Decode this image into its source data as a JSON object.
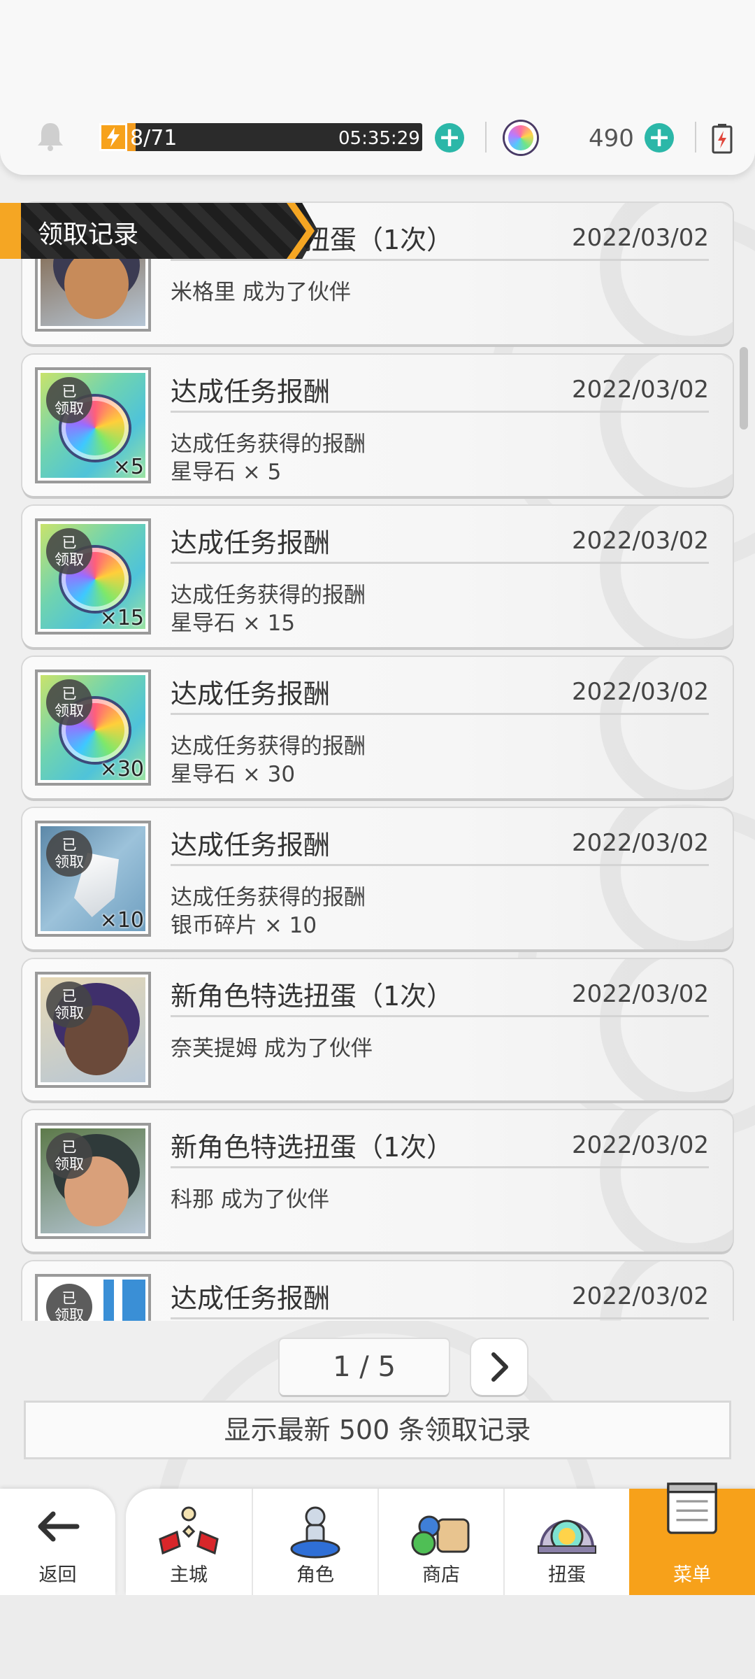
{
  "topbar": {
    "stamina_text": "8/71",
    "stamina_fraction": 0.113,
    "stamina_timer": "05:35:29",
    "gem_count": "490",
    "icons": [
      "bell-icon",
      "lightning-icon",
      "plus-icon",
      "rainbow-orb-icon",
      "battery-icon"
    ]
  },
  "section": {
    "title": "领取记录"
  },
  "records": [
    {
      "title": "新角色特选扭蛋（1次）",
      "date": "2022/03/02",
      "line1": "米格里 成为了伙伴",
      "line2": "",
      "thumb": "character",
      "qty": "",
      "claimed": false
    },
    {
      "title": "达成任务报酬",
      "date": "2022/03/02",
      "line1": "达成任务获得的报酬",
      "line2": "星导石 × 5",
      "thumb": "star-stone",
      "qty": "×5",
      "claimed": true
    },
    {
      "title": "达成任务报酬",
      "date": "2022/03/02",
      "line1": "达成任务获得的报酬",
      "line2": "星导石 × 15",
      "thumb": "star-stone",
      "qty": "×15",
      "claimed": true
    },
    {
      "title": "达成任务报酬",
      "date": "2022/03/02",
      "line1": "达成任务获得的报酬",
      "line2": "星导石 × 30",
      "thumb": "star-stone",
      "qty": "×30",
      "claimed": true
    },
    {
      "title": "达成任务报酬",
      "date": "2022/03/02",
      "line1": "达成任务获得的报酬",
      "line2": "银币碎片 × 10",
      "thumb": "silver-shard",
      "qty": "×10",
      "claimed": true
    },
    {
      "title": "新角色特选扭蛋（1次）",
      "date": "2022/03/02",
      "line1": "奈芙提姆 成为了伙伴",
      "line2": "",
      "thumb": "character",
      "qty": "",
      "claimed": true
    },
    {
      "title": "新角色特选扭蛋（1次）",
      "date": "2022/03/02",
      "line1": "科那 成为了伙伴",
      "line2": "",
      "thumb": "character",
      "qty": "",
      "claimed": true
    },
    {
      "title": "达成任务报酬",
      "date": "2022/03/02",
      "line1": "",
      "line2": "",
      "thumb": "coin",
      "qty": "",
      "claimed": true
    }
  ],
  "claimed_badge": "已领取",
  "claimed_badge_line1": "已",
  "claimed_badge_line2": "领取",
  "pagination": {
    "label": "1 / 5",
    "next_icon": "chevron-right-icon"
  },
  "note": "显示最新 500 条领取记录",
  "nav": {
    "back_label": "返回",
    "items": [
      {
        "label": "主城",
        "icon": "castle-icon"
      },
      {
        "label": "角色",
        "icon": "character-icon"
      },
      {
        "label": "商店",
        "icon": "shop-icon"
      },
      {
        "label": "扭蛋",
        "icon": "gacha-icon"
      },
      {
        "label": "菜单",
        "icon": "menu-icon",
        "active": true
      }
    ]
  },
  "colors": {
    "accent": "#f7a11a",
    "teal": "#2bb7a8",
    "dark": "#2b2b2b"
  }
}
